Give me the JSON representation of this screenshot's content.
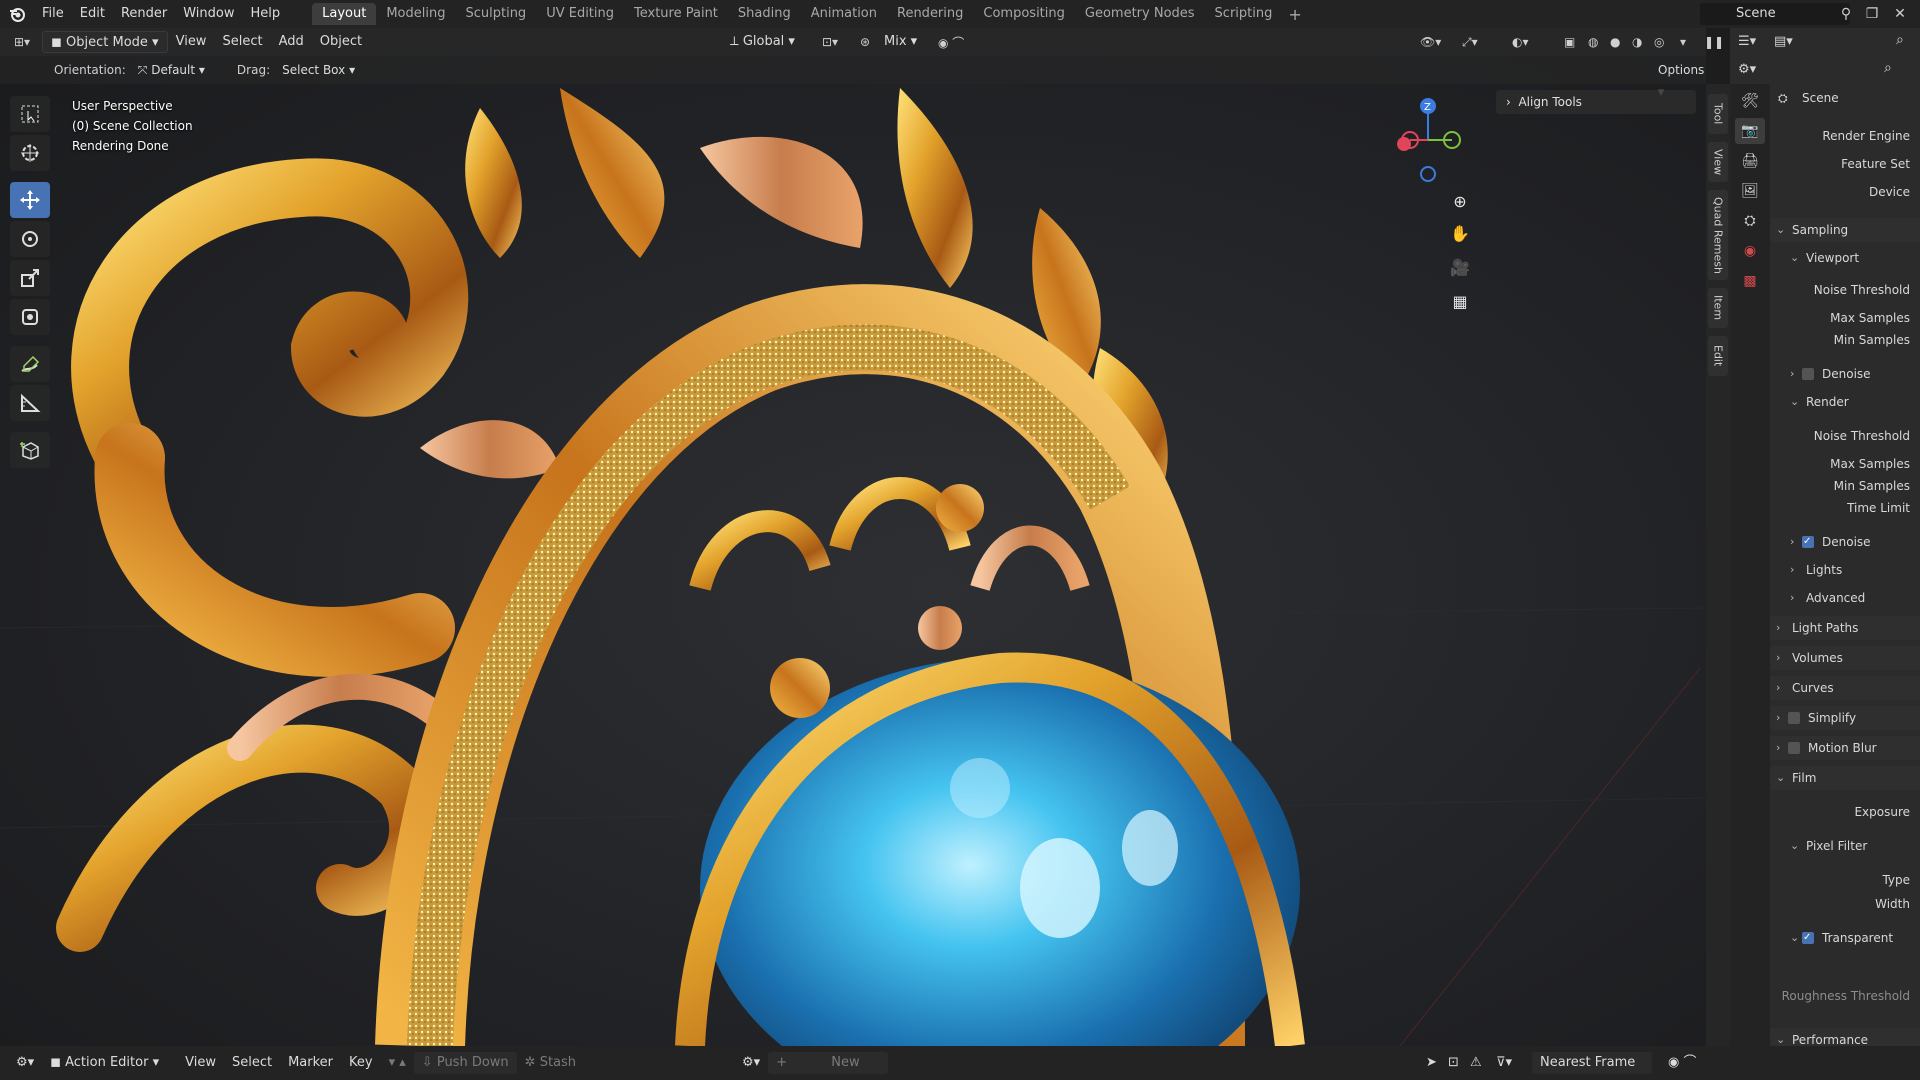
{
  "menubar": {
    "items": [
      "File",
      "Edit",
      "Render",
      "Window",
      "Help"
    ],
    "workspaces": [
      "Layout",
      "Modeling",
      "Sculpting",
      "UV Editing",
      "Texture Paint",
      "Shading",
      "Animation",
      "Rendering",
      "Compositing",
      "Geometry Nodes",
      "Scripting"
    ],
    "active_workspace": "Layout",
    "add_tab": "+",
    "scene_name": "Scene"
  },
  "viewport_header": {
    "mode": "Object Mode",
    "menus": [
      "View",
      "Select",
      "Add",
      "Object"
    ],
    "transform_space": "Global",
    "pivot_mix": "Mix",
    "options": "Options"
  },
  "tool_settings": {
    "orientation_label": "Orientation:",
    "orientation_value": "Default",
    "drag_label": "Drag:",
    "drag_value": "Select Box"
  },
  "viewport_overlay": {
    "line1": "User Perspective",
    "line2": "(0) Scene Collection",
    "line3": "Rendering Done"
  },
  "gizmo": {
    "z_label": "Z"
  },
  "align_tools": "Align Tools",
  "sidebar_tabs": [
    "Tool",
    "View",
    "Quad Remesh",
    "Item",
    "Edit"
  ],
  "properties": {
    "header_title": "Scene",
    "rows": {
      "render_engine": "Render Engine",
      "feature_set": "Feature Set",
      "device": "Device",
      "sampling": "Sampling",
      "viewport": "Viewport",
      "vp_noise_threshold": "Noise Threshold",
      "vp_max_samples": "Max Samples",
      "vp_min_samples": "Min Samples",
      "vp_denoise": "Denoise",
      "render": "Render",
      "r_noise_threshold": "Noise Threshold",
      "r_max_samples": "Max Samples",
      "r_min_samples": "Min Samples",
      "r_time_limit": "Time Limit",
      "r_denoise": "Denoise",
      "lights": "Lights",
      "advanced": "Advanced",
      "light_paths": "Light Paths",
      "volumes": "Volumes",
      "curves": "Curves",
      "simplify": "Simplify",
      "motion_blur": "Motion Blur",
      "film": "Film",
      "exposure": "Exposure",
      "pixel_filter": "Pixel Filter",
      "type": "Type",
      "width": "Width",
      "transparent": "Transparent",
      "roughness_threshold": "Roughness Threshold",
      "performance": "Performance"
    },
    "checkbox_states": {
      "vp_denoise": false,
      "r_denoise": true,
      "simplify": false,
      "motion_blur": false,
      "transparent": true
    }
  },
  "bottombar": {
    "editor": "Action Editor",
    "menus": [
      "View",
      "Select",
      "Marker",
      "Key"
    ],
    "push_down": "Push Down",
    "stash": "Stash",
    "new": "New",
    "snap": "Nearest Frame"
  },
  "colors": {
    "accent": "#4772b3",
    "gold": "#d9a030",
    "jewel": "#2a8fd4",
    "axis_x": "#e0455a",
    "axis_y": "#7cc13a",
    "axis_z": "#3a7ce0"
  }
}
